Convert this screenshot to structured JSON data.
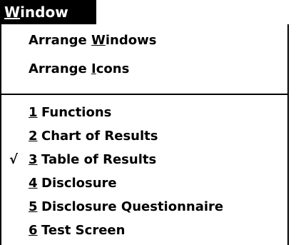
{
  "menu": {
    "title_accel": "W",
    "title_rest": "indow"
  },
  "items": {
    "arrange_windows": {
      "pre": "Arrange ",
      "accel": "W",
      "post": "indows"
    },
    "arrange_icons": {
      "pre": "Arrange ",
      "accel": "I",
      "post": "cons"
    }
  },
  "windows": [
    {
      "num": "1",
      "label": "Functions",
      "checked": false
    },
    {
      "num": "2",
      "label": "Chart of Results",
      "checked": false
    },
    {
      "num": "3",
      "label": "Table of Results",
      "checked": true,
      "check_glyph": "√"
    },
    {
      "num": "4",
      "label": "Disclosure",
      "checked": false
    },
    {
      "num": "5",
      "label": "Disclosure Questionnaire",
      "checked": false
    },
    {
      "num": "6",
      "label": "Test Screen",
      "checked": false
    }
  ]
}
